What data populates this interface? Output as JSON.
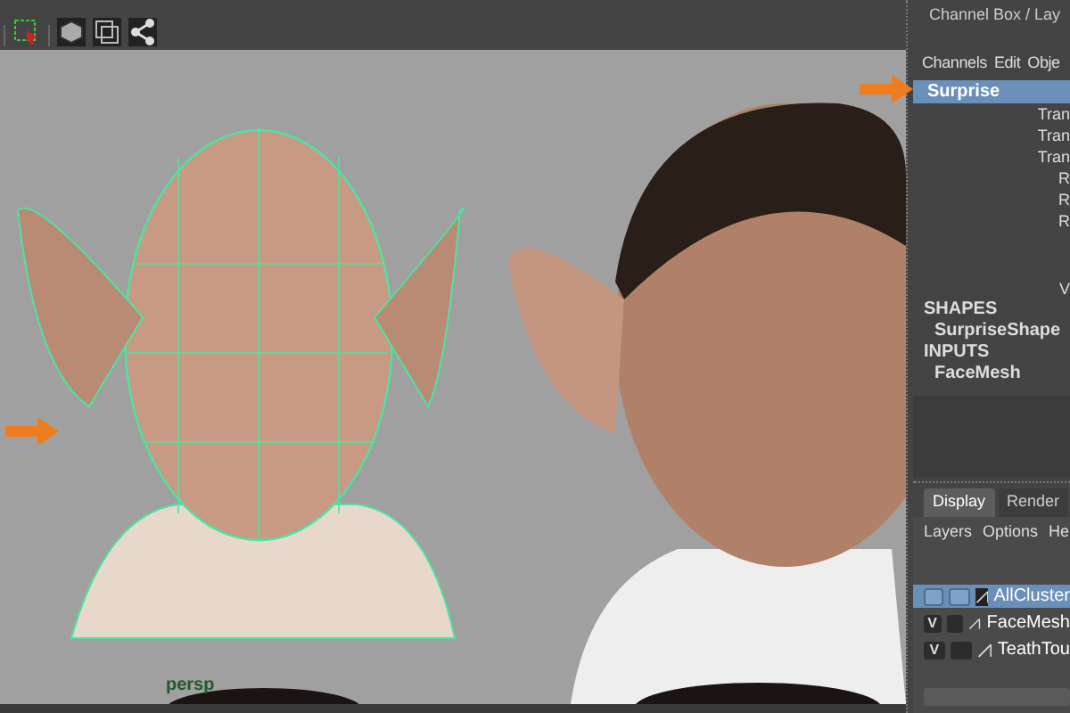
{
  "viewport": {
    "camera_label": "persp"
  },
  "channel_box": {
    "title": "Channel Box / Lay",
    "menu": [
      "Channels",
      "Edit",
      "Obje"
    ],
    "object": {
      "name": "Surprise",
      "selected": true
    },
    "attributes": [
      "Tran",
      "Tran",
      "Tran",
      "R",
      "R",
      "R",
      "V"
    ],
    "shapes_heading": "SHAPES",
    "shapes": [
      "SurpriseShape"
    ],
    "inputs_heading": "INPUTS",
    "inputs": [
      "FaceMesh"
    ]
  },
  "layer_editor": {
    "tabs": [
      {
        "label": "Display",
        "selected": true
      },
      {
        "label": "Render",
        "selected": false
      }
    ],
    "menu": [
      "Layers",
      "Options",
      "He"
    ],
    "layers": [
      {
        "name": "AllCluster",
        "selected": true
      },
      {
        "name": "FaceMesh",
        "selected": false,
        "visibility": "V"
      },
      {
        "name": "TeathTou",
        "selected": false,
        "visibility": "V"
      }
    ]
  }
}
